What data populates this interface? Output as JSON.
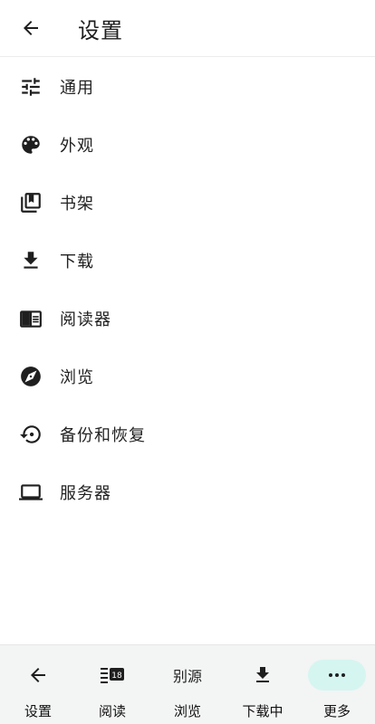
{
  "app_bar": {
    "title": "设置"
  },
  "settings": {
    "items": [
      {
        "label": "通用",
        "icon": "tune-icon"
      },
      {
        "label": "外观",
        "icon": "palette-icon"
      },
      {
        "label": "书架",
        "icon": "bookshelf-icon"
      },
      {
        "label": "下载",
        "icon": "download-icon"
      },
      {
        "label": "阅读器",
        "icon": "reader-icon"
      },
      {
        "label": "浏览",
        "icon": "compass-icon"
      },
      {
        "label": "备份和恢复",
        "icon": "restore-icon"
      },
      {
        "label": "服务器",
        "icon": "laptop-icon"
      }
    ]
  },
  "bottom_nav": {
    "items": [
      {
        "label": "设置",
        "icon": "back-arrow-icon"
      },
      {
        "label": "阅读",
        "icon": "calendar-badge-icon"
      },
      {
        "label": "浏览",
        "icon": "source-icon"
      },
      {
        "label": "下载中",
        "icon": "download-icon"
      },
      {
        "label": "更多",
        "icon": "more-icon",
        "active": true
      }
    ],
    "badge_number": "18",
    "source_glyph": "别源"
  },
  "colors": {
    "active_pill": "#d5f5f1",
    "bottom_bar_bg": "#f3f4f4",
    "icon": "#1f1f1f"
  }
}
